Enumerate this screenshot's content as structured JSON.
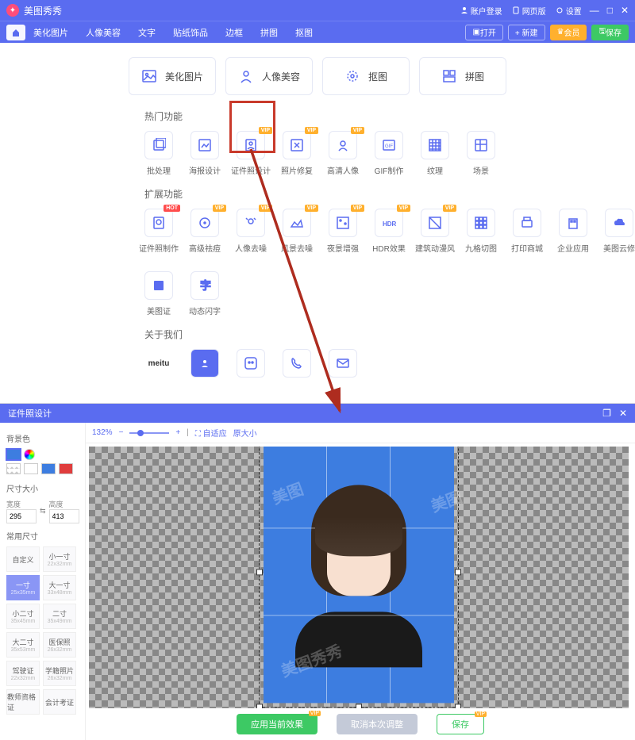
{
  "app": {
    "title": "美图秀秀"
  },
  "titlebar": {
    "login": "账户登录",
    "web": "网页版",
    "settings": "设置"
  },
  "nav": {
    "items": [
      "美化图片",
      "人像美容",
      "文字",
      "贴纸饰品",
      "边框",
      "拼图",
      "抠图"
    ],
    "open": "打开",
    "new": "+ 新建",
    "vip": "会员",
    "save": "保存"
  },
  "quick": [
    {
      "label": "美化图片"
    },
    {
      "label": "人像美容"
    },
    {
      "label": "抠图"
    },
    {
      "label": "拼图"
    }
  ],
  "sections": {
    "hot_title": "热门功能",
    "ext_title": "扩展功能",
    "about_title": "关于我们"
  },
  "hot": [
    {
      "label": "批处理",
      "tag": ""
    },
    {
      "label": "海报设计",
      "tag": ""
    },
    {
      "label": "证件照设计",
      "tag": "VIP",
      "highlight": true
    },
    {
      "label": "照片修复",
      "tag": "VIP"
    },
    {
      "label": "高清人像",
      "tag": "VIP"
    },
    {
      "label": "GIF制作",
      "tag": ""
    },
    {
      "label": "纹理",
      "tag": ""
    },
    {
      "label": "场景",
      "tag": ""
    }
  ],
  "ext": [
    {
      "label": "证件照制作",
      "tag": "HOT"
    },
    {
      "label": "高级祛痘",
      "tag": "VIP"
    },
    {
      "label": "人像去噪",
      "tag": "VIP"
    },
    {
      "label": "风景去噪",
      "tag": "VIP"
    },
    {
      "label": "夜景增强",
      "tag": "VIP"
    },
    {
      "label": "HDR效果",
      "tag": "VIP"
    },
    {
      "label": "建筑动漫风",
      "tag": "VIP"
    },
    {
      "label": "九格切图",
      "tag": ""
    },
    {
      "label": "打印商城",
      "tag": ""
    },
    {
      "label": "企业应用",
      "tag": ""
    },
    {
      "label": "美图云修",
      "tag": ""
    },
    {
      "label": "美图证",
      "tag": ""
    },
    {
      "label": "动态闪字",
      "tag": ""
    }
  ],
  "about": [
    {
      "label": "meitu"
    },
    {
      "label": ""
    },
    {
      "label": ""
    },
    {
      "label": ""
    },
    {
      "label": ""
    }
  ],
  "editor": {
    "title": "证件照设计",
    "zoom": "132%",
    "fit": "自适应",
    "orig": "原大小",
    "sidebar": {
      "bg_label": "背景色",
      "size_label": "尺寸大小",
      "w_label": "宽度",
      "h_label": "高度",
      "w": "295",
      "h": "413",
      "common_label": "常用尺寸",
      "sizes": [
        {
          "t": "自定义",
          "s": ""
        },
        {
          "t": "小一寸",
          "s": "22x32mm"
        },
        {
          "t": "一寸",
          "s": "25x35mm"
        },
        {
          "t": "大一寸",
          "s": "33x48mm"
        },
        {
          "t": "小二寸",
          "s": "35x45mm"
        },
        {
          "t": "二寸",
          "s": "35x49mm"
        },
        {
          "t": "大二寸",
          "s": "35x53mm"
        },
        {
          "t": "医保照",
          "s": "26x32mm"
        },
        {
          "t": "驾驶证",
          "s": "22x32mm"
        },
        {
          "t": "学籍照片",
          "s": "26x32mm"
        },
        {
          "t": "教师资格证",
          "s": ""
        },
        {
          "t": "会计考证",
          "s": ""
        }
      ]
    },
    "actions": {
      "apply": "应用当前效果",
      "cancel": "取消本次调整",
      "save": "保存"
    }
  }
}
